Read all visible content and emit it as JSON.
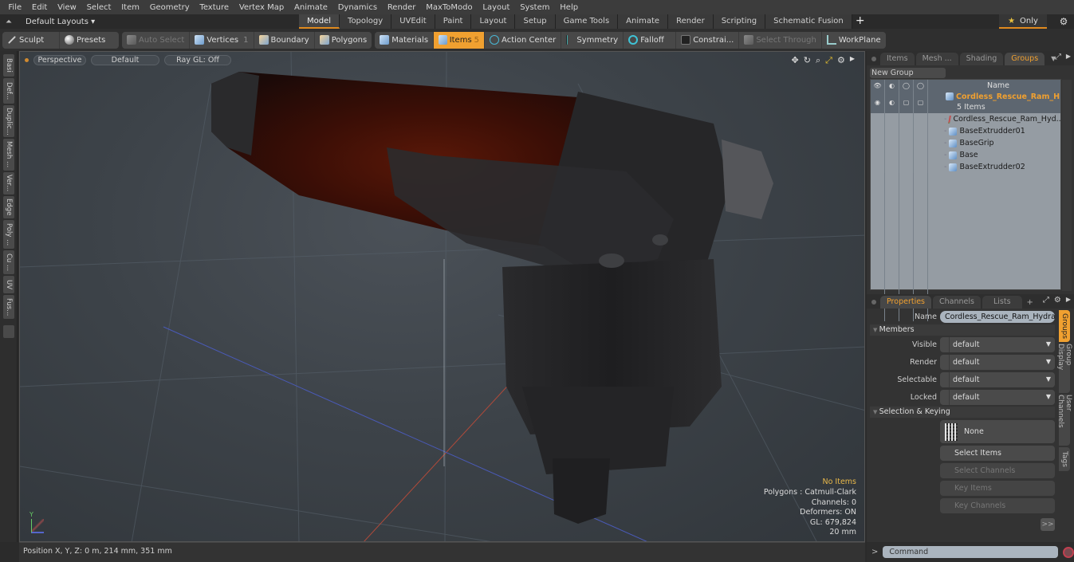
{
  "menubar": [
    "File",
    "Edit",
    "View",
    "Select",
    "Item",
    "Geometry",
    "Texture",
    "Vertex Map",
    "Animate",
    "Dynamics",
    "Render",
    "MaxToModo",
    "Layout",
    "System",
    "Help"
  ],
  "layoutbar": {
    "layouts_label": "Default Layouts ▾",
    "tabs": [
      "Model",
      "Topology",
      "UVEdit",
      "Paint",
      "Layout",
      "Setup",
      "Game Tools",
      "Animate",
      "Render",
      "Scripting",
      "Schematic Fusion"
    ],
    "active_tab": "Model",
    "add_tab": "+",
    "only_label": "Only"
  },
  "toolbar": {
    "sculpt": "Sculpt",
    "presets": "Presets",
    "auto_select": "Auto Select",
    "vertices": "Vertices",
    "vertices_count": "1",
    "boundary": "Boundary",
    "polygons": "Polygons",
    "materials": "Materials",
    "items": "Items",
    "items_count": "5",
    "action_center": "Action Center",
    "symmetry": "Symmetry",
    "falloff": "Falloff",
    "constraints": "Constrai...",
    "select_through": "Select Through",
    "workplane": "WorkPlane"
  },
  "left_tabs": [
    "Basi",
    "Def...",
    "Duplic...",
    "Mesh ...",
    "Ver...",
    "Edge",
    "Poly ...",
    "Cu ...",
    "UV",
    "Fus..."
  ],
  "viewport": {
    "view": "Perspective",
    "shading": "Default",
    "raygl": "Ray GL: Off",
    "stats": {
      "items": "No Items",
      "polygons": "Polygons : Catmull-Clark",
      "channels": "Channels: 0",
      "deformers": "Deformers: ON",
      "gl": "GL: 679,824",
      "scale": "20 mm"
    },
    "axis_label": "Y"
  },
  "statusbar": {
    "position": "Position X, Y, Z:   0 m, 214 mm, 351 mm"
  },
  "groups_panel": {
    "tabs": [
      "Items",
      "Mesh ...",
      "Shading",
      "Groups"
    ],
    "active_tab": "Groups",
    "new_group": "New Group",
    "column_name": "Name",
    "group": {
      "name": "Cordless_Rescue_Ram_H ...",
      "count": "5 Items"
    },
    "children": [
      {
        "name": "Cordless_Rescue_Ram_Hyd...",
        "type": "locator"
      },
      {
        "name": "BaseExtrudder01",
        "type": "mesh"
      },
      {
        "name": "BaseGrip",
        "type": "mesh"
      },
      {
        "name": "Base",
        "type": "mesh"
      },
      {
        "name": "BaseExtrudder02",
        "type": "mesh"
      }
    ]
  },
  "properties_panel": {
    "tabs": [
      "Properties",
      "Channels",
      "Lists"
    ],
    "active_tab": "Properties",
    "add_tab": "+",
    "name_label": "Name",
    "name_value": "Cordless_Rescue_Ram_Hydraulic",
    "members_section": "Members",
    "fields": [
      {
        "label": "Visible",
        "value": "default"
      },
      {
        "label": "Render",
        "value": "default"
      },
      {
        "label": "Selectable",
        "value": "default"
      },
      {
        "label": "Locked",
        "value": "default"
      }
    ],
    "selection_section": "Selection & Keying",
    "selection_value": "None",
    "buttons": [
      {
        "label": "Select Items",
        "enabled": true
      },
      {
        "label": "Select Channels",
        "enabled": false
      },
      {
        "label": "Key Items",
        "enabled": false
      },
      {
        "label": "Key Channels",
        "enabled": false
      }
    ],
    "more": ">>",
    "side_tabs": [
      "Groups",
      "Group Display",
      "User Channels",
      "Tags"
    ],
    "active_side_tab": "Groups"
  },
  "command": {
    "prompt": ">",
    "placeholder": "Command"
  },
  "colors": {
    "accent": "#f0a030",
    "selected_group_text": "#f0a030",
    "warning_text": "#e8b84a"
  }
}
